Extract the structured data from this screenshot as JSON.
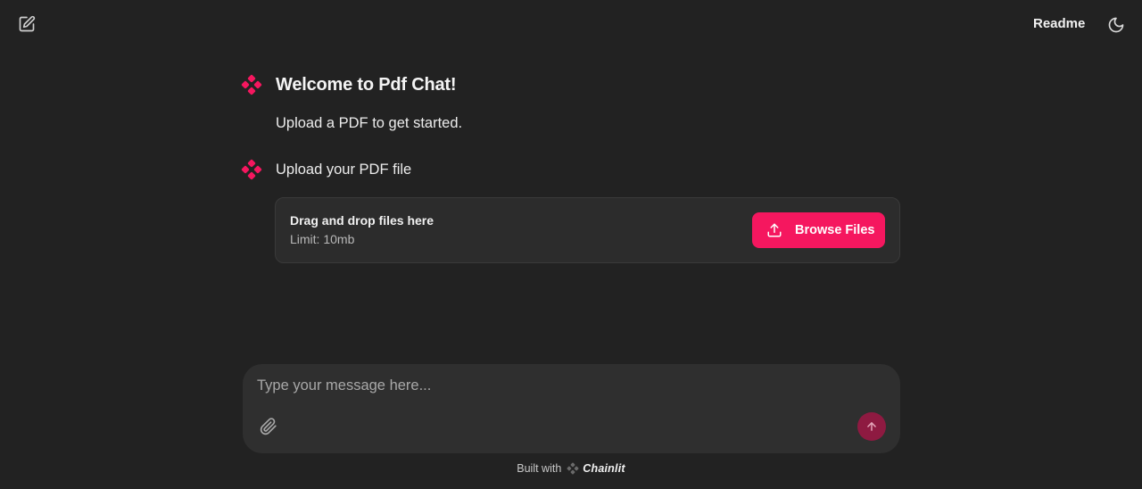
{
  "header": {
    "new_chat_icon": "edit-square-icon",
    "readme_label": "Readme",
    "theme_icon": "moon-icon"
  },
  "messages": [
    {
      "avatar_icon": "chainlit-logo-icon",
      "title": "Welcome to Pdf Chat!",
      "body": "Upload a PDF to get started."
    },
    {
      "avatar_icon": "chainlit-logo-icon",
      "body": "Upload your PDF file"
    }
  ],
  "upload": {
    "drag_text": "Drag and drop files here",
    "limit_text": "Limit: 10mb",
    "browse_label": "Browse Files",
    "browse_icon": "upload-icon"
  },
  "composer": {
    "placeholder": "Type your message here...",
    "value": "",
    "attach_icon": "paperclip-icon",
    "send_icon": "arrow-up-icon"
  },
  "footer": {
    "built_with": "Built with",
    "brand": "Chainlit"
  },
  "colors": {
    "background": "#222222",
    "accent": "#f5175f",
    "send_disabled": "#8e1a41",
    "card": "#2c2c2c",
    "composer": "#2f2f2f"
  }
}
